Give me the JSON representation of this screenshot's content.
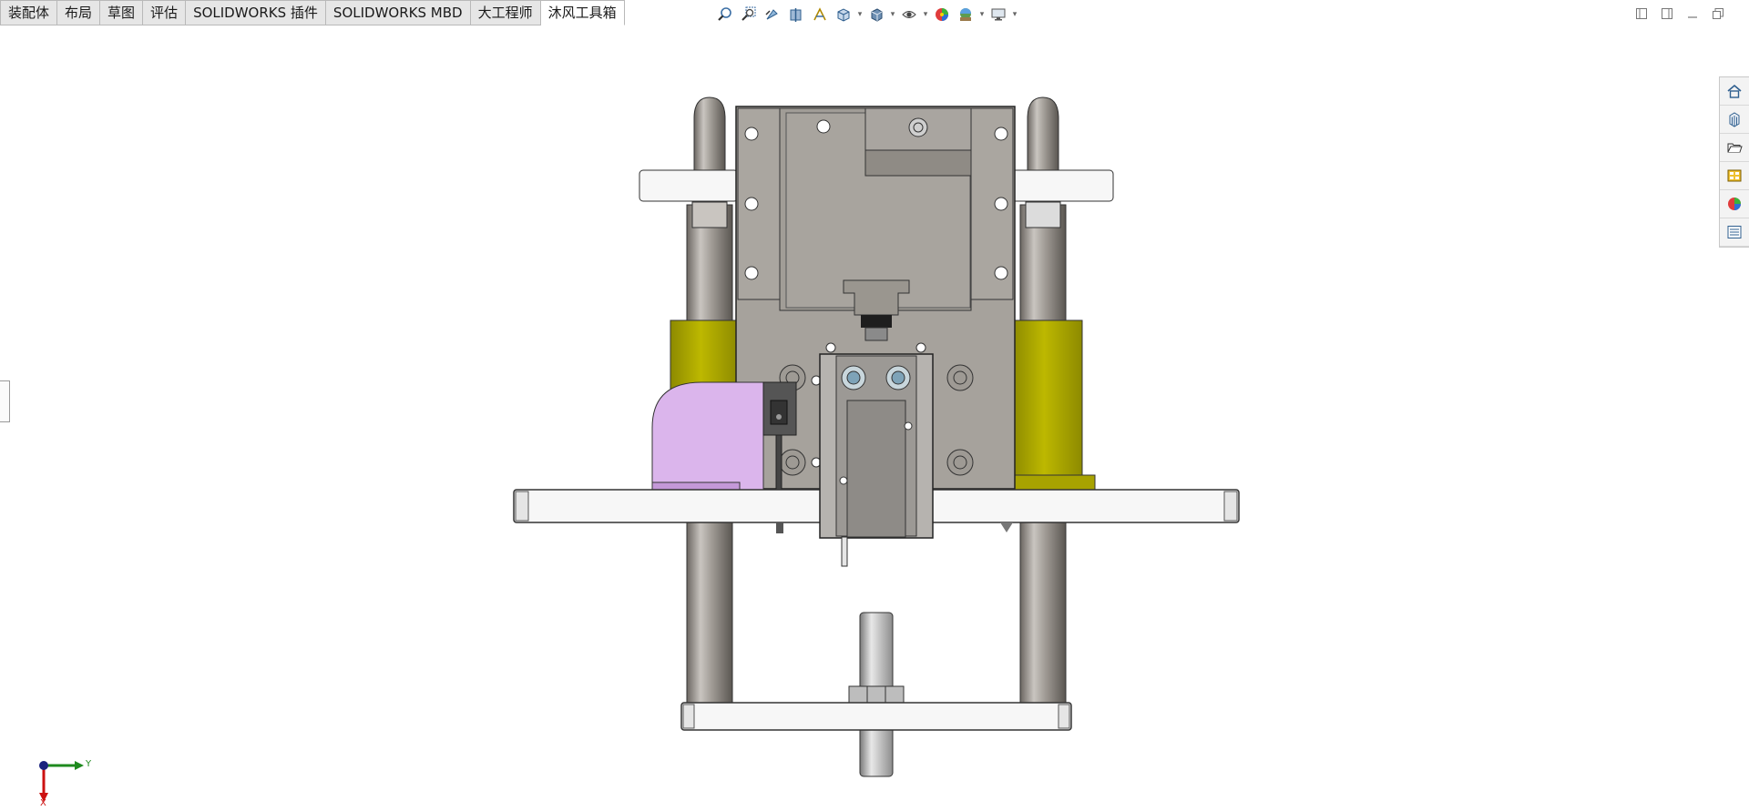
{
  "tabs": [
    {
      "label": "装配体"
    },
    {
      "label": "布局"
    },
    {
      "label": "草图"
    },
    {
      "label": "评估"
    },
    {
      "label": "SOLIDWORKS 插件"
    },
    {
      "label": "SOLIDWORKS MBD"
    },
    {
      "label": "大工程师"
    },
    {
      "label": "沐风工具箱"
    }
  ],
  "active_tab": "沐风工具箱",
  "heads_up_toolbar": [
    "zoom-to-fit-icon",
    "zoom-to-area-icon",
    "previous-view-icon",
    "section-view-icon",
    "dynamic-annotation-icon",
    "view-orientation-icon",
    "display-style-icon",
    "hide-show-items-icon",
    "edit-appearance-icon",
    "apply-scene-icon",
    "view-settings-icon"
  ],
  "task_pane": [
    "solidworks-resources-icon",
    "design-library-icon",
    "file-explorer-icon",
    "view-palette-icon",
    "appearances-scenes-icon",
    "custom-properties-icon"
  ],
  "triad": {
    "y_axis": "Y",
    "x_axis": "X"
  },
  "colors": {
    "model_grey": "#a6a29c",
    "yellow_part": "#b3b000",
    "pink_part": "#dbb5ec",
    "y_axis": "#1e8a1e",
    "x_axis": "#cc1111"
  }
}
